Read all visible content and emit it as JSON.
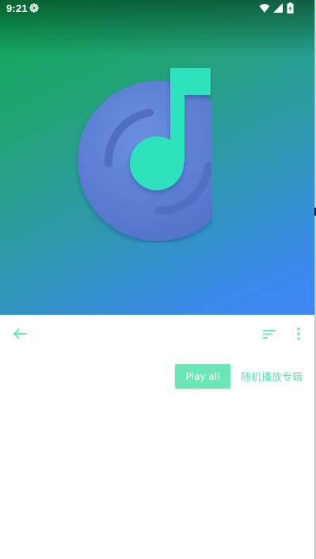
{
  "status_bar": {
    "time": "9:21",
    "settings_icon": "gear-icon",
    "wifi_icon": "wifi-icon",
    "signal_icon": "signal-icon",
    "battery_icon": "battery-charging-icon"
  },
  "header": {
    "artwork_icon": "music-disc-note-icon",
    "colors": {
      "gradient_start": "#0fa855",
      "gradient_end": "#3e86f5",
      "disc": "#5d80d6",
      "note": "#2ee2bd"
    }
  },
  "toolbar": {
    "back_icon": "arrow-left-icon",
    "sort_icon": "sort-icon",
    "more_icon": "more-vertical-icon"
  },
  "actions": {
    "play_all_label": "Play all",
    "shuffle_label": "随机播放专辑"
  },
  "colors": {
    "accent": "#69e8b6",
    "accent_text": "#5fdeb0"
  }
}
